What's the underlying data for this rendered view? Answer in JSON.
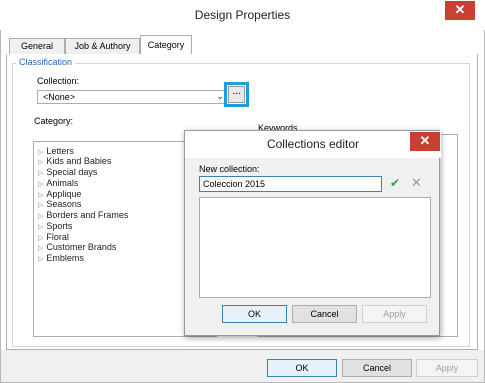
{
  "window": {
    "title": "Design Properties",
    "close_glyph": "✕"
  },
  "tabs": [
    {
      "label": "General"
    },
    {
      "label": "Job & Authory"
    },
    {
      "label": "Category"
    }
  ],
  "classification": {
    "group_label": "Classification",
    "collection_label": "Collection:",
    "collection_value": "<None>",
    "browse_label": "...",
    "category_label": "Category:",
    "categories": [
      "Letters",
      "Kids and Babies",
      "Special days",
      "Animals",
      "Applique",
      "Seasons",
      "Borders and Frames",
      "Sports",
      "Floral",
      "Customer Brands",
      "Emblems"
    ],
    "keywords_label": "Keywords"
  },
  "footer": {
    "ok": "OK",
    "cancel": "Cancel",
    "apply": "Apply"
  },
  "collections_editor": {
    "title": "Collections editor",
    "close_glyph": "✕",
    "new_collection_label": "New collection:",
    "new_collection_value": "Coleccion 2015",
    "confirm_glyph": "✔",
    "clear_glyph": "✕",
    "ok": "OK",
    "cancel": "Cancel",
    "apply": "Apply"
  },
  "colors": {
    "close_red": "#c74132",
    "accent_blue": "#1e9fd9",
    "group_label_blue": "#2f63b8",
    "confirm_green": "#2ea44f"
  }
}
